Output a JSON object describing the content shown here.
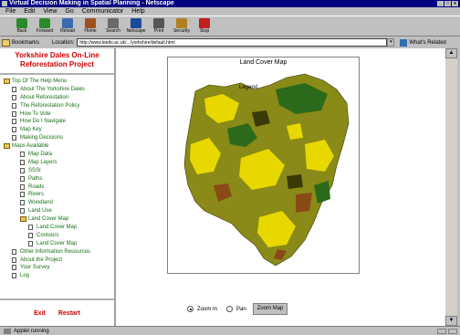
{
  "window": {
    "title": "Virtual Decision Making in Spatial Planning - Netscape"
  },
  "menu": [
    "File",
    "Edit",
    "View",
    "Go",
    "Communicator",
    "Help"
  ],
  "toolbar": [
    {
      "label": "Back",
      "icon": "back-arrow-icon",
      "color": "#2a8a2a"
    },
    {
      "label": "Forward",
      "icon": "forward-arrow-icon",
      "color": "#2a8a2a"
    },
    {
      "label": "Reload",
      "icon": "reload-icon",
      "color": "#3a6ab0"
    },
    {
      "label": "Home",
      "icon": "home-icon",
      "color": "#a05020"
    },
    {
      "label": "Search",
      "icon": "search-icon",
      "color": "#6a6a6a"
    },
    {
      "label": "Netscape",
      "icon": "netscape-icon",
      "color": "#1a4a9a"
    },
    {
      "label": "Print",
      "icon": "print-icon",
      "color": "#555555"
    },
    {
      "label": "Security",
      "icon": "security-lock-icon",
      "color": "#b08020"
    },
    {
      "label": "Stop",
      "icon": "stop-icon",
      "color": "#c02020"
    }
  ],
  "location": {
    "bookmarks_label": "Bookmarks",
    "label": "Location:",
    "url": "http://www.leeds.ac.uk/.../yorkshire/default.html",
    "related_label": "What's Related"
  },
  "left": {
    "title_line1": "Yorkshire Dales On-Line",
    "title_line2": "Reforestation Project",
    "tree": [
      {
        "label": "Top Of The Help Menu",
        "indent": 0,
        "kind": "folder"
      },
      {
        "label": "About The Yorkshire Dales",
        "indent": 1,
        "kind": "doc"
      },
      {
        "label": "About Reforestation",
        "indent": 1,
        "kind": "doc"
      },
      {
        "label": "The Reforestation Policy",
        "indent": 1,
        "kind": "doc"
      },
      {
        "label": "How To Vote",
        "indent": 1,
        "kind": "doc"
      },
      {
        "label": "How Do I Navigate",
        "indent": 1,
        "kind": "doc"
      },
      {
        "label": "Map Key",
        "indent": 1,
        "kind": "doc"
      },
      {
        "label": "Making Decisions",
        "indent": 1,
        "kind": "doc"
      },
      {
        "label": "Maps Available",
        "indent": 0,
        "kind": "folder"
      },
      {
        "label": "Map Data",
        "indent": 2,
        "kind": "doc"
      },
      {
        "label": "Map Layers",
        "indent": 2,
        "kind": "doc"
      },
      {
        "label": "SSSI",
        "indent": 2,
        "kind": "doc"
      },
      {
        "label": "Paths",
        "indent": 2,
        "kind": "doc"
      },
      {
        "label": "Roads",
        "indent": 2,
        "kind": "doc"
      },
      {
        "label": "Rivers",
        "indent": 2,
        "kind": "doc"
      },
      {
        "label": "Woodland",
        "indent": 2,
        "kind": "doc"
      },
      {
        "label": "Land Use",
        "indent": 2,
        "kind": "doc"
      },
      {
        "label": "Land Cover Map",
        "indent": 2,
        "kind": "folder"
      },
      {
        "label": "Land Cover Map",
        "indent": 3,
        "kind": "doc"
      },
      {
        "label": "Contours",
        "indent": 3,
        "kind": "doc"
      },
      {
        "label": "Land Cover Map",
        "indent": 3,
        "kind": "doc"
      },
      {
        "label": "Other Information Resources",
        "indent": 1,
        "kind": "doc"
      },
      {
        "label": "About the Project",
        "indent": 1,
        "kind": "doc"
      },
      {
        "label": "Your Survey",
        "indent": 1,
        "kind": "doc"
      },
      {
        "label": "Log",
        "indent": 1,
        "kind": "doc"
      }
    ],
    "footer": {
      "left": "Exit",
      "right": "Restart"
    }
  },
  "main": {
    "map_title": "Land Cover Map",
    "legend_label": "Legend",
    "radio_in_label": "Zoom In",
    "radio_out_label": "Pan",
    "zoom_button": "Zoom Map"
  },
  "status": {
    "text": "Applet running"
  },
  "colors": {
    "map_olive": "#8a8a18",
    "map_yellow": "#e8d800",
    "map_green": "#2a6a1a",
    "map_brown": "#8a4a18",
    "link_green": "#167016",
    "title_red": "#cc0000"
  }
}
